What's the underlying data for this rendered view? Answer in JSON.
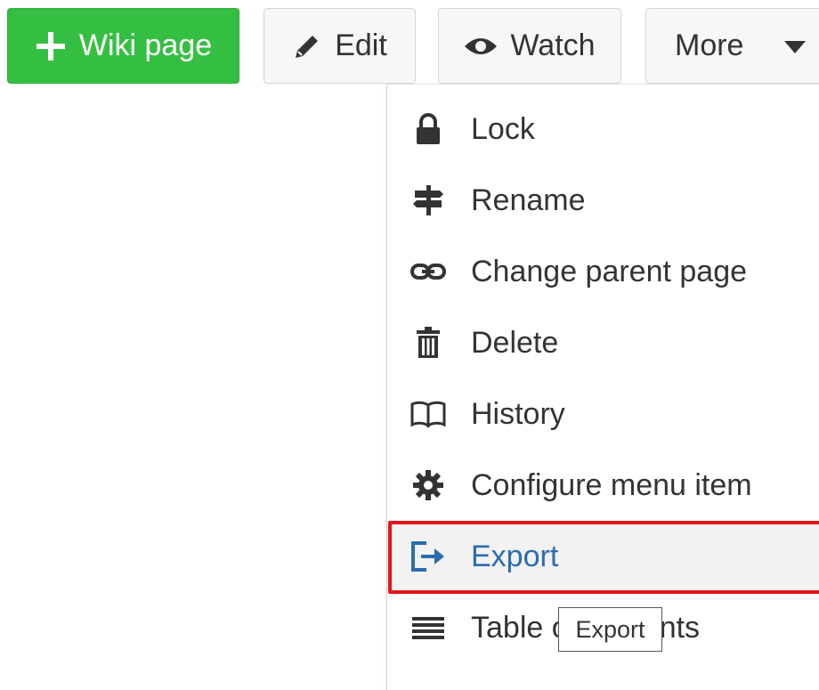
{
  "toolbar": {
    "wiki_page_label": "Wiki page",
    "edit_label": "Edit",
    "watch_label": "Watch",
    "more_label": "More"
  },
  "more_menu": {
    "items": [
      {
        "label": "Lock",
        "icon": "lock-icon"
      },
      {
        "label": "Rename",
        "icon": "signpost-icon"
      },
      {
        "label": "Change parent page",
        "icon": "link-icon"
      },
      {
        "label": "Delete",
        "icon": "trash-icon"
      },
      {
        "label": "History",
        "icon": "book-icon"
      },
      {
        "label": "Configure menu item",
        "icon": "gear-icon"
      },
      {
        "label": "Export",
        "icon": "export-icon",
        "state": "hovered"
      },
      {
        "label": "Table of contents",
        "icon": "list-icon"
      }
    ]
  },
  "tooltip": {
    "text": "Export"
  },
  "colors": {
    "primary_button": "#35bf42",
    "highlight_border": "#e4141b",
    "active_item_text": "#2b6cb0"
  }
}
